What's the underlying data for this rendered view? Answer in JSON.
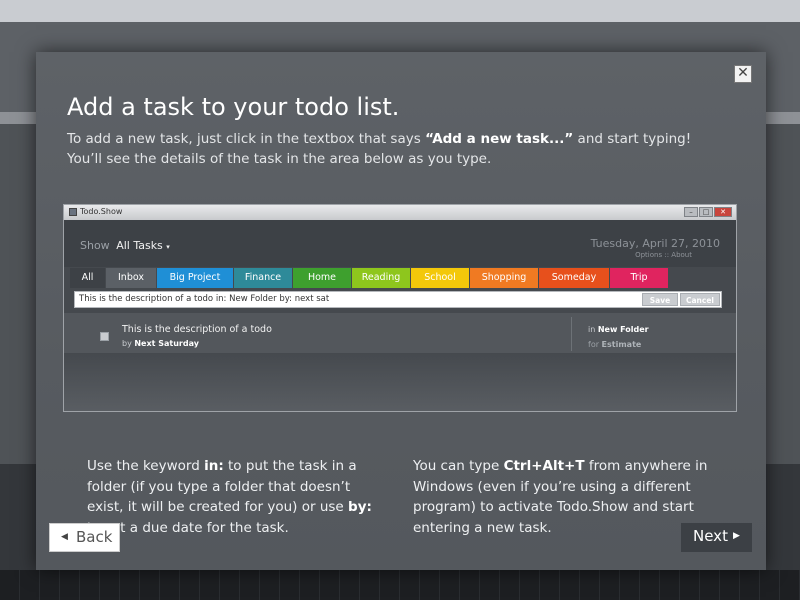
{
  "modal": {
    "title": "Add a task to your todo list.",
    "intro_part1": "To add a new task, just click in the textbox that says ",
    "intro_bold": "“Add a new task...”",
    "intro_part2": " and start typing!",
    "intro_line2": "You’ll see the details of the task in the area below as you type.",
    "close_glyph": "✕",
    "back_label": "Back",
    "next_label": "Next"
  },
  "preview": {
    "window_title": "Todo.Show",
    "show_label": "Show",
    "show_value": "All Tasks",
    "date": "Tuesday, April 27, 2010",
    "options": "Options",
    "about": "About",
    "tabs": [
      {
        "label": "All",
        "color": "#3d4146"
      },
      {
        "label": "Inbox",
        "color": "#5b6066"
      },
      {
        "label": "Big Project",
        "color": "#1f8fd6"
      },
      {
        "label": "Finance",
        "color": "#2e8a99"
      },
      {
        "label": "Home",
        "color": "#3ea02e"
      },
      {
        "label": "Reading",
        "color": "#8ec61d"
      },
      {
        "label": "School",
        "color": "#f3c80a"
      },
      {
        "label": "Shopping",
        "color": "#f07a22"
      },
      {
        "label": "Someday",
        "color": "#e7501c"
      },
      {
        "label": "Trip",
        "color": "#e0245f"
      }
    ],
    "input_value": "This is the description of a todo in: New Folder by: next sat",
    "save_label": "Save",
    "cancel_label": "Cancel",
    "task": {
      "description": "This is the description of a todo",
      "by_prefix": "by",
      "by_value": "Next Saturday",
      "in_prefix": "in",
      "in_value": "New Folder",
      "for_prefix": "for",
      "for_value": "Estimate"
    }
  },
  "tips": {
    "left_part1": "Use the keyword ",
    "left_kw1": "in:",
    "left_part2": " to put the task in a folder (if you type a folder that doesn’t exist, it will be created for you) or use ",
    "left_kw2": "by:",
    "left_part3": " to set a due date for the task.",
    "right_part1": "You can type ",
    "right_kw": "Ctrl+Alt+T",
    "right_part2": " from anywhere in Windows (even if you’re using a different program) to activate Todo.Show and start entering a new task."
  },
  "icons": {
    "back": "left-triangle-icon",
    "next": "right-triangle-icon",
    "close": "close-icon"
  }
}
